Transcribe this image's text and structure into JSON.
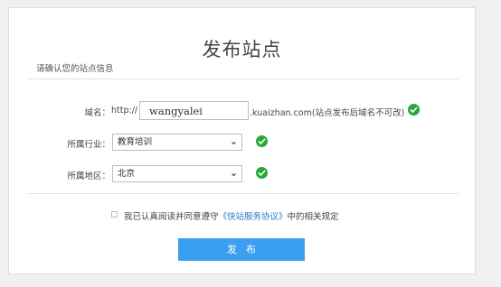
{
  "page": {
    "title": "发布站点",
    "subtitle": "请确认您的站点信息"
  },
  "form": {
    "domain": {
      "label": "域名：",
      "prefix": "http://",
      "value": "wangyalei",
      "suffix": ".kuaizhan.com(站点发布后域名不可改)",
      "valid": true
    },
    "industry": {
      "label": "所属行业：",
      "selected": "教育培训",
      "valid": true
    },
    "region": {
      "label": "所属地区：",
      "selected": "北京",
      "valid": true
    }
  },
  "agreement": {
    "checked": false,
    "text_before": "我已认真阅读并同意遵守",
    "link_text": "《快站服务协议》",
    "text_after": "中的相关规定"
  },
  "actions": {
    "publish_label": "发布"
  },
  "colors": {
    "accent": "#3a9ff0",
    "valid": "#2aa63a",
    "link": "#2c76c9"
  },
  "icons": {
    "valid": "check-circle-icon",
    "dropdown": "chevron-down-icon"
  }
}
